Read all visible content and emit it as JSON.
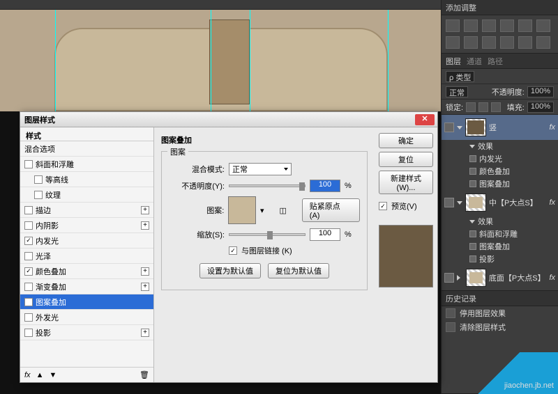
{
  "dialog": {
    "title": "图层样式",
    "styles_header": "样式",
    "blend_options": "混合选项",
    "effects": [
      {
        "key": "bevel",
        "label": "斜面和浮雕",
        "checked": false,
        "plus": false
      },
      {
        "key": "contour",
        "label": "等高线",
        "checked": false,
        "plus": false,
        "indent": true
      },
      {
        "key": "texture",
        "label": "纹理",
        "checked": false,
        "plus": false,
        "indent": true
      },
      {
        "key": "stroke",
        "label": "描边",
        "checked": false,
        "plus": true
      },
      {
        "key": "inner_shadow",
        "label": "内阴影",
        "checked": false,
        "plus": true
      },
      {
        "key": "inner_glow",
        "label": "内发光",
        "checked": true,
        "plus": false
      },
      {
        "key": "satin",
        "label": "光泽",
        "checked": false,
        "plus": false
      },
      {
        "key": "color_overlay",
        "label": "颜色叠加",
        "checked": true,
        "plus": true
      },
      {
        "key": "gradient_overlay",
        "label": "渐变叠加",
        "checked": false,
        "plus": true
      },
      {
        "key": "pattern_overlay",
        "label": "图案叠加",
        "checked": true,
        "plus": false,
        "active": true
      },
      {
        "key": "outer_glow",
        "label": "外发光",
        "checked": false,
        "plus": false
      },
      {
        "key": "drop_shadow",
        "label": "投影",
        "checked": false,
        "plus": true
      }
    ],
    "footer_fx": "fx",
    "center": {
      "section_title": "图案叠加",
      "group_title": "图案",
      "blend_mode_label": "混合模式:",
      "blend_mode_value": "正常",
      "opacity_label": "不透明度(Y):",
      "opacity_value": "100",
      "percent": "%",
      "pattern_label": "图案:",
      "snap_origin": "贴紧原点 (A)",
      "scale_label": "缩放(S):",
      "scale_value": "100",
      "link_label": "与图层链接 (K)",
      "link_checked": true,
      "set_default": "设置为默认值",
      "reset_default": "复位为默认值"
    },
    "right": {
      "ok": "确定",
      "cancel": "复位",
      "new_style": "新建样式(W)...",
      "preview_label": "预览(V)",
      "preview_checked": true
    }
  },
  "panels": {
    "adjustments_title": "添加调整",
    "layers_tab": "图层",
    "channels_tab": "通道",
    "paths_tab": "路径",
    "kind_label": "ρ 类型",
    "blend_mode": "正常",
    "opacity_label": "不透明度:",
    "opacity_value": "100%",
    "lock_label": "锁定:",
    "fill_label": "填充:",
    "fill_value": "100%",
    "layers": [
      {
        "name": "竖",
        "selected": true,
        "fx": [
          "效果",
          "内发光",
          "颜色叠加",
          "图案叠加"
        ],
        "thumb": "dark"
      },
      {
        "name": "中【P大点S】",
        "selected": false,
        "fx": [
          "效果",
          "斜面和浮雕",
          "图案叠加",
          "投影"
        ],
        "thumb": "light"
      },
      {
        "name": "底面【P大点S】",
        "selected": false,
        "fx": [],
        "thumb": "light"
      }
    ],
    "layer_fx_suffix": "fx",
    "history_title": "历史记录",
    "history": [
      "停用图层效果",
      "清除图层样式"
    ]
  },
  "watermark": "jiaochen.jb.net"
}
